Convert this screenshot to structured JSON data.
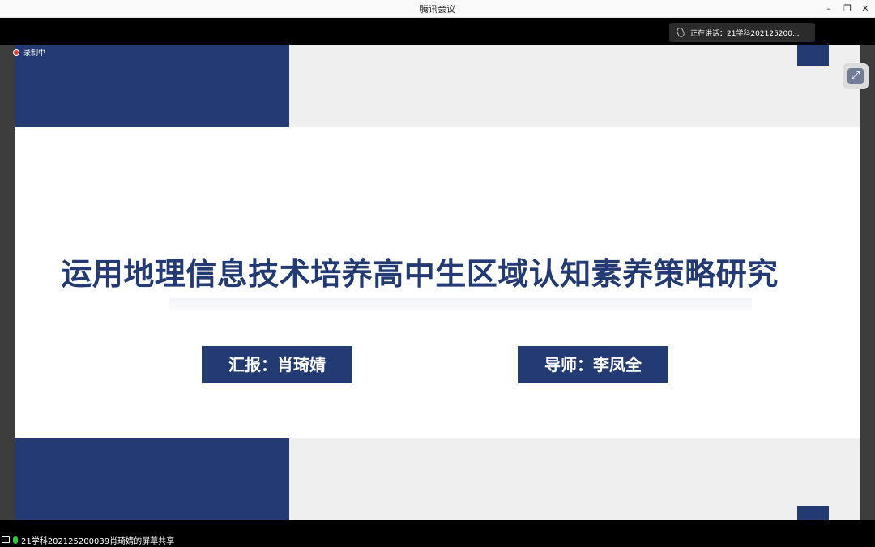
{
  "window": {
    "title": "腾讯会议",
    "minimize": "–",
    "restore": "❐",
    "close": "✕"
  },
  "recording": {
    "label": "录制中"
  },
  "speaking": {
    "text": "正在讲话：21学科202125200..."
  },
  "slide": {
    "title": "运用地理信息技术培养高中生区域认知素养策略研究",
    "reporter": "汇报：肖琦婧",
    "advisor": "导师：李凤全"
  },
  "status": {
    "share_text": "21学科202125200039肖琦婧的屏幕共享"
  },
  "colors": {
    "navy": "#243a73",
    "band": "#efefef"
  }
}
